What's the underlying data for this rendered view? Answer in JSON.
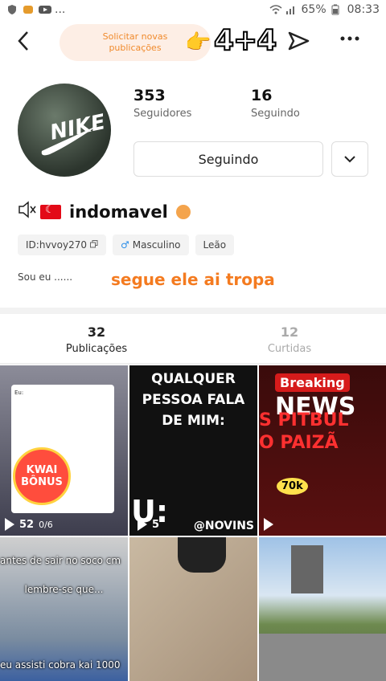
{
  "status_bar": {
    "battery": "65%",
    "time": "08:33",
    "dots": "..."
  },
  "header": {
    "request_label": "Solicitar novas publicações",
    "overlay_text": "4+4"
  },
  "profile": {
    "followers_count": "353",
    "followers_label": "Seguidores",
    "following_count": "16",
    "following_label": "Seguindo",
    "follow_button": "Seguindo",
    "avatar_text": "NIKE",
    "username": "indomavel",
    "tags": {
      "id": "ID:hvvoy270",
      "gender": "Masculino",
      "sign": "Leão"
    },
    "bio": "Sou eu ......",
    "caption_overlay": "segue ele ai tropa"
  },
  "tabs": {
    "posts_count": "32",
    "posts_label": "Publicações",
    "likes_count": "12",
    "likes_label": "Curtidas"
  },
  "grid": {
    "t1": {
      "kwai_top": "KWAI",
      "kwai_bottom": "BÔNUS",
      "views": "52",
      "progress": "0/6",
      "small_text": "Eu:"
    },
    "t2": {
      "text": "QUALQUER PESSOA FALA DE MIM:",
      "u": "U:",
      "handle": "@NOVINS",
      "views": "5"
    },
    "t3": {
      "breaking": "Breaking",
      "news": "NEWS",
      "line1": "S PITBUL",
      "line2": "O PAIZÃ",
      "k70": "70k"
    },
    "t4": {
      "line1": "antes de sair no soco cm",
      "line2": "lembre-se que...",
      "line3": "eu assisti cobra kai 1000"
    }
  }
}
